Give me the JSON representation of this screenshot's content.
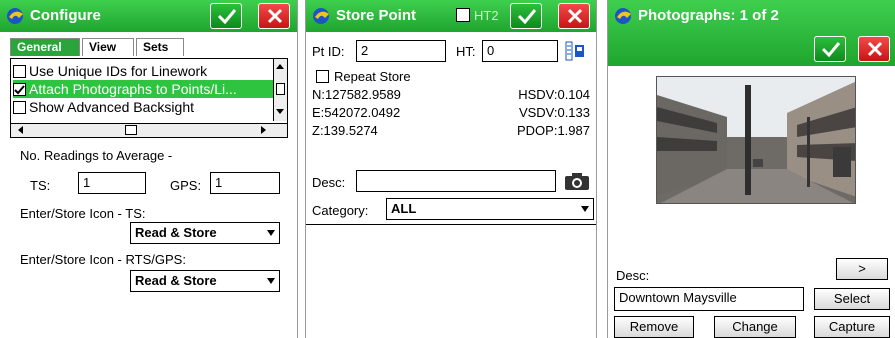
{
  "configure": {
    "title": "Configure",
    "tabs": [
      "General",
      "View",
      "Sets"
    ],
    "options": [
      {
        "label": "Use Unique IDs for Linework",
        "checked": false
      },
      {
        "label": "Attach Photographs to Points/Li...",
        "checked": true
      },
      {
        "label": "Show Advanced Backsight",
        "checked": false
      }
    ],
    "readings_label": "No. Readings to Average -",
    "ts_label": "TS:",
    "ts_value": "1",
    "gps_label": "GPS:",
    "gps_value": "1",
    "icon_ts_label": "Enter/Store Icon - TS:",
    "icon_ts_value": "Read & Store",
    "icon_gps_label": "Enter/Store Icon - RTS/GPS:",
    "icon_gps_value": "Read & Store"
  },
  "store_point": {
    "title": "Store Point",
    "ht2_label": "HT2",
    "pt_id_label": "Pt ID:",
    "pt_id_value": "2",
    "ht_label": "HT:",
    "ht_value": "0",
    "repeat_label": "Repeat Store",
    "n": "N:127582.9589",
    "e": "E:542072.0492",
    "z": "Z:139.5274",
    "hsdv": "HSDV:0.104",
    "vsdv": "VSDV:0.133",
    "pdop": "PDOP:1.987",
    "desc_label": "Desc:",
    "desc_value": "",
    "category_label": "Category:",
    "category_value": "ALL"
  },
  "photographs": {
    "title": "Photographs: 1 of 2",
    "next_label": ">",
    "desc_label": "Desc:",
    "desc_value": "Downtown Maysville",
    "select_label": "Select",
    "remove_label": "Remove",
    "change_label": "Change",
    "capture_label": "Capture"
  },
  "colors": {
    "titlebar": "#2aa53a",
    "selection": "#2ec43f",
    "close": "#d42020"
  }
}
